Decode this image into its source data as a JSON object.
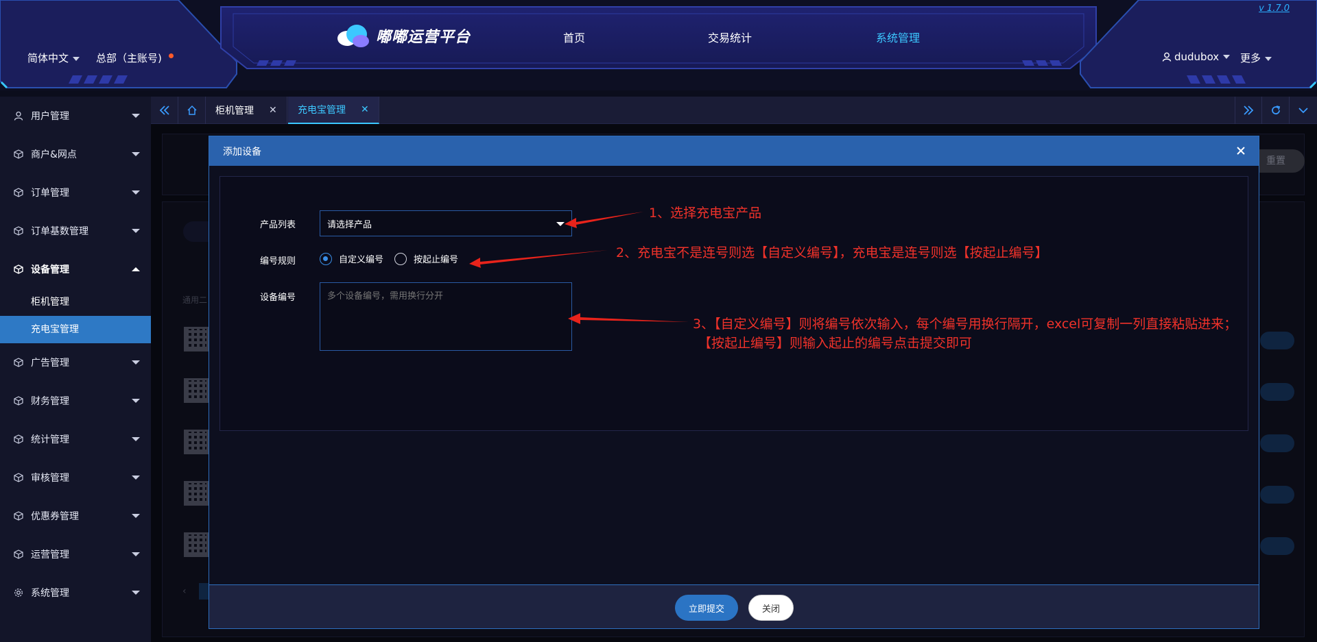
{
  "header": {
    "language": "简体中文",
    "org": "总部（主账号)",
    "app_title": "嘟嘟运营平台",
    "version": "v 1.7.0",
    "nav": [
      {
        "label": "首页"
      },
      {
        "label": "交易统计"
      },
      {
        "label": "系统管理",
        "active": true
      }
    ],
    "username": "dudubox",
    "more": "更多"
  },
  "sidebar": {
    "items": [
      {
        "label": "用户管理",
        "icon": "user-icon"
      },
      {
        "label": "商户&网点",
        "icon": "cube-icon"
      },
      {
        "label": "订单管理",
        "icon": "cube-icon"
      },
      {
        "label": "订单基数管理",
        "icon": "cube-icon"
      },
      {
        "label": "设备管理",
        "icon": "cube-icon",
        "open": true
      },
      {
        "label": "广告管理",
        "icon": "cube-icon"
      },
      {
        "label": "财务管理",
        "icon": "cube-icon"
      },
      {
        "label": "统计管理",
        "icon": "cube-icon"
      },
      {
        "label": "审核管理",
        "icon": "cube-icon"
      },
      {
        "label": "优惠券管理",
        "icon": "cube-icon"
      },
      {
        "label": "运营管理",
        "icon": "cube-icon"
      },
      {
        "label": "系统管理",
        "icon": "gear-icon"
      }
    ],
    "subitems": [
      {
        "label": "柜机管理"
      },
      {
        "label": "充电宝管理",
        "active": true
      }
    ]
  },
  "tabs": [
    {
      "label": "柜机管理"
    },
    {
      "label": "充电宝管理",
      "active": true
    }
  ],
  "background": {
    "reset_label": "重置",
    "column_label": "通用二"
  },
  "modal": {
    "title": "添加设备",
    "product_label": "产品列表",
    "product_value": "请选择产品",
    "rule_label": "编号规则",
    "rule_options": [
      "自定义编号",
      "按起止编号"
    ],
    "rule_selected": "自定义编号",
    "device_label": "设备编号",
    "device_placeholder": "多个设备编号，需用换行分开",
    "submit_label": "立即提交",
    "close_label": "关闭"
  },
  "annotations": {
    "step1": "1、选择充电宝产品",
    "step2": "2、充电宝不是连号则选【自定义编号】，充电宝是连号则选【按起止编号】",
    "step3_line1": "3、【自定义编号】则将编号依次输入，每个编号用换行隔开，excel可复制一列直接粘贴进来；",
    "step3_line2": "【按起止编号】则输入起止的编号点击提交即可"
  },
  "colors": {
    "accent": "#3cc8ff",
    "primary": "#2b74c4",
    "annotation": "#f0322a",
    "sidebar_active": "#2e79c5"
  }
}
